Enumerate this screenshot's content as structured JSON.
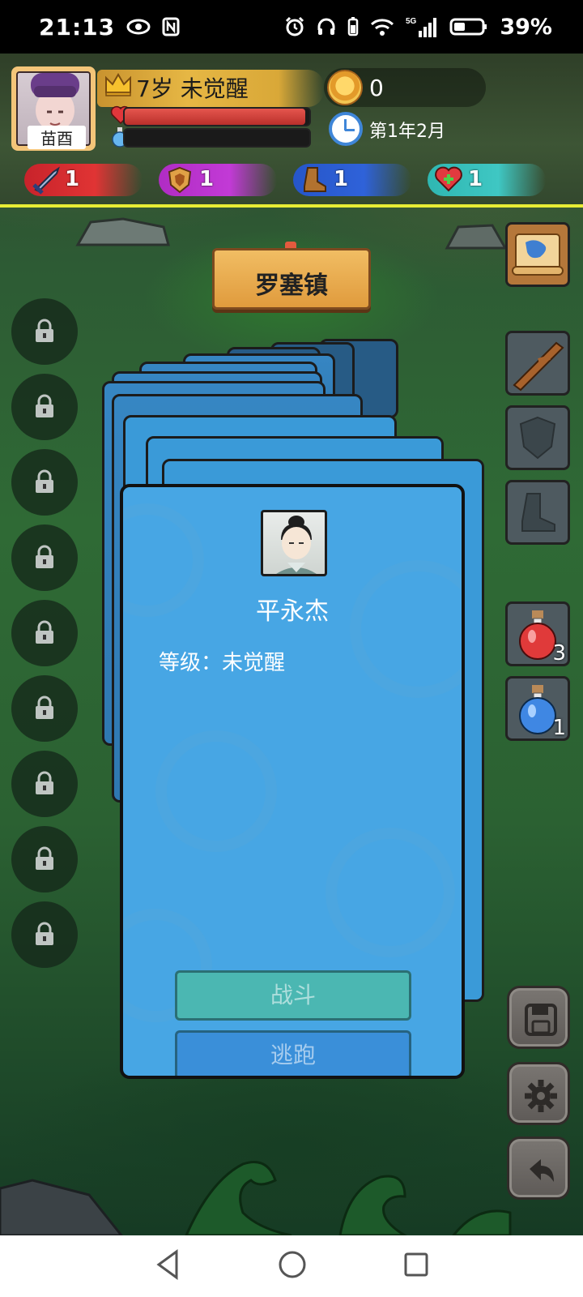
{
  "status_bar": {
    "time": "21:13",
    "battery": "39%",
    "network": "5G"
  },
  "player": {
    "name": "苗酉",
    "age_status": "7岁 未觉醒",
    "hp_fraction": 0.98,
    "mp_fraction": 0.0,
    "gold": "0",
    "date": "第1年2月"
  },
  "stats": [
    {
      "name": "attack",
      "value": "1",
      "color": "#e03434"
    },
    {
      "name": "defense",
      "value": "1",
      "color": "#c23ad6"
    },
    {
      "name": "speed",
      "value": "1",
      "color": "#2f62d9"
    },
    {
      "name": "health",
      "value": "1",
      "color": "#3fc7c3"
    }
  ],
  "location": "罗塞镇",
  "locked_slots": 9,
  "equipment": {
    "weapon": "stick-icon",
    "armor": "shield-icon",
    "boots": "boot-icon"
  },
  "potions": {
    "red_count": "3",
    "blue_count": "1"
  },
  "encounter": {
    "name": "平永杰",
    "level_label": "等级:",
    "level_value": "未觉醒",
    "level_text": "等级：未觉醒",
    "fight_label": "战斗",
    "flee_label": "逃跑"
  },
  "colors": {
    "hud_line": "#e8ec35",
    "card_blue": "#47a6e4",
    "hp_red": "#d6413a"
  }
}
